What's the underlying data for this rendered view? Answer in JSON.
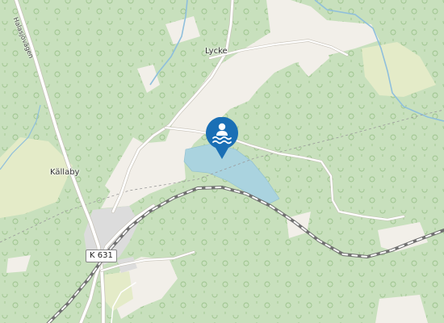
{
  "map": {
    "places": [
      {
        "name": "Lycke"
      },
      {
        "name": "Källaby"
      }
    ],
    "road_label": "Halasjövägen",
    "route_shield": "K 631",
    "marker": {
      "icon": "swimming-icon",
      "color": "#1a6fb5"
    }
  },
  "colors": {
    "forest": "#c8e0bd",
    "open_land": "#f2efe9",
    "farmland": "#e4ebc8",
    "water": "#aad3df",
    "residential": "#dcdcdc",
    "road": "#ffffff",
    "railway": "#707070"
  }
}
